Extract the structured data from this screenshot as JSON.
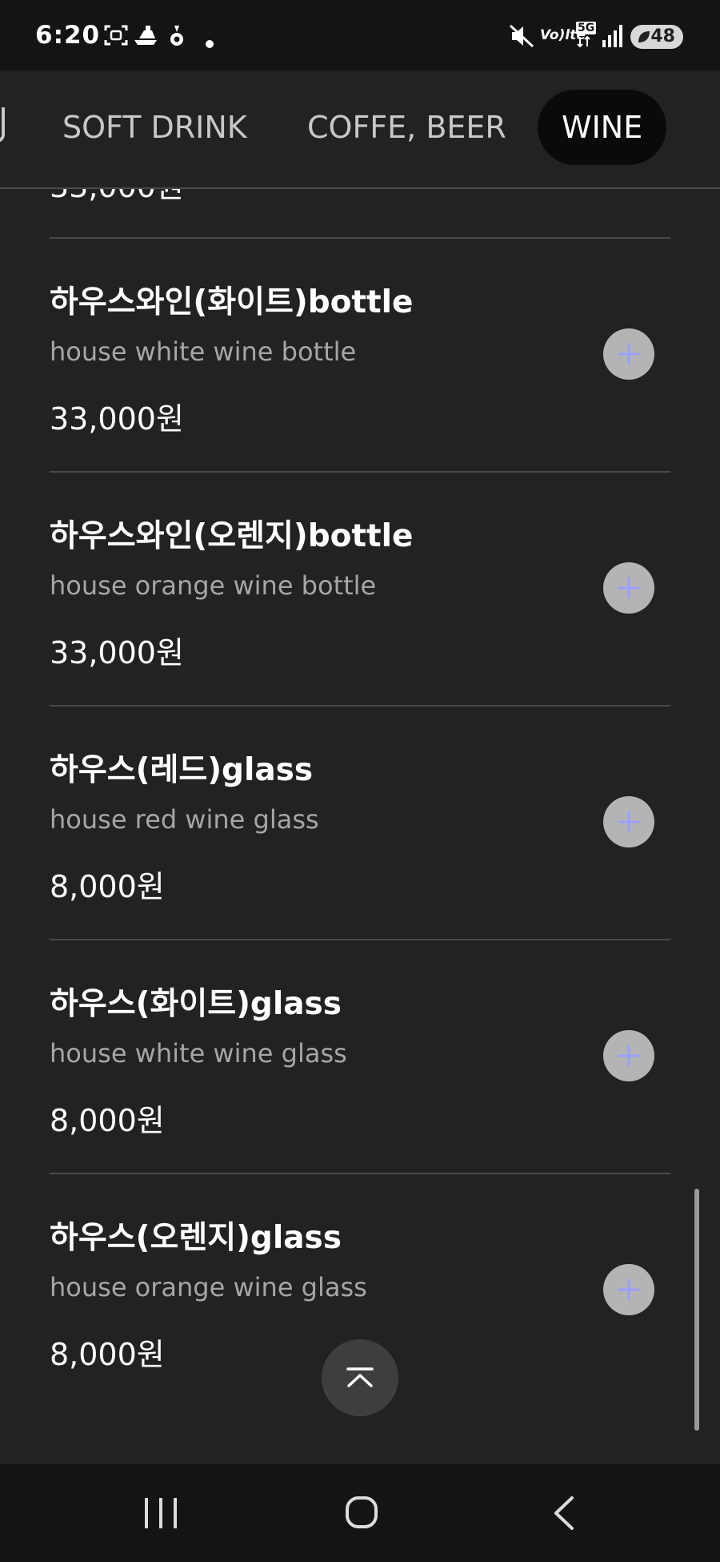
{
  "status_bar": {
    "time": "6:20",
    "left_icons": [
      "screenshot-icon",
      "boat-icon",
      "notification-drop-icon",
      "dot-icon"
    ],
    "right_icons": [
      "mute-icon",
      "volte-icon",
      "5g-icon",
      "signal-icon"
    ],
    "volte_label": "Vo)",
    "volte_sub": "lte",
    "network_label": "5G",
    "battery_level": "48"
  },
  "tabs": [
    {
      "label": "SOFT DRINK",
      "active": false
    },
    {
      "label": "COFFE, BEER",
      "active": false
    },
    {
      "label": "WINE",
      "active": true
    }
  ],
  "partial_item": {
    "price": "33,000원"
  },
  "menu_items": [
    {
      "name": "하우스와인(화이트)bottle",
      "description": "house white wine bottle",
      "price": "33,000원"
    },
    {
      "name": "하우스와인(오렌지)bottle",
      "description": "house orange wine bottle",
      "price": "33,000원"
    },
    {
      "name": "하우스(레드)glass",
      "description": "house red wine glass",
      "price": "8,000원"
    },
    {
      "name": "하우스(화이트)glass",
      "description": "house white wine glass",
      "price": "8,000원"
    },
    {
      "name": "하우스(오렌지)glass",
      "description": "house orange wine glass",
      "price": "8,000원"
    }
  ],
  "icons": {
    "add": "plus-icon",
    "scroll_top": "chevron-up-icon",
    "nav_recent": "recent-apps-icon",
    "nav_home": "home-icon",
    "nav_back": "back-icon"
  },
  "colors": {
    "background": "#222222",
    "status_bar": "#141414",
    "active_tab": "#0a0a0a",
    "add_button": "#b4b4b4",
    "plus_accent": "#9aa0ff",
    "description_text": "#a6a6a6"
  }
}
